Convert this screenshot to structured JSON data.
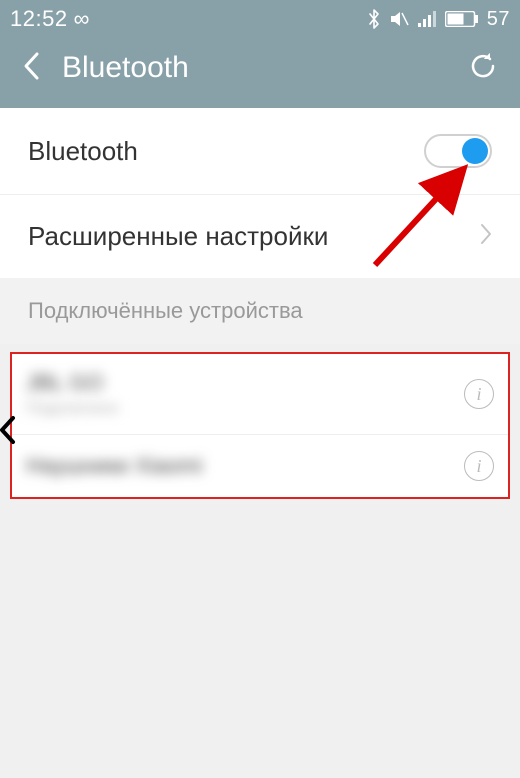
{
  "status": {
    "time": "12:52",
    "battery": "57"
  },
  "header": {
    "title": "Bluetooth"
  },
  "rows": {
    "bluetooth_label": "Bluetooth",
    "advanced_label": "Расширенные настройки"
  },
  "section": {
    "connected": "Подключённые устройства"
  },
  "devices": [
    {
      "name": "JBL GO",
      "sub": "Подключено"
    },
    {
      "name": "Наушники Xiaomi",
      "sub": ""
    }
  ]
}
